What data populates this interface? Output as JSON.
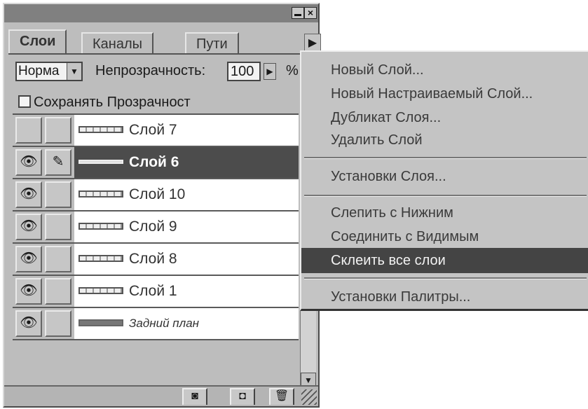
{
  "palette": {
    "tabs": [
      "Слои",
      "Каналы",
      "Пути"
    ],
    "blend_mode": "Норма",
    "opacity_label": "Непрозрачность:",
    "opacity_value": "100",
    "opacity_unit": "%",
    "preserve_transparency_label": "Сохранять Прозрачност",
    "layers": [
      {
        "name": "Слой 7",
        "visible": false,
        "active": false
      },
      {
        "name": "Слой 6",
        "visible": true,
        "active": true
      },
      {
        "name": "Слой 10",
        "visible": true,
        "active": false
      },
      {
        "name": "Слой 9",
        "visible": true,
        "active": false
      },
      {
        "name": "Слой 8",
        "visible": true,
        "active": false
      },
      {
        "name": "Слой 1",
        "visible": true,
        "active": false
      },
      {
        "name": "Задний план",
        "visible": true,
        "active": false
      }
    ],
    "icons": {
      "eye": "eye-icon",
      "brush": "brush-icon",
      "mask": "layer-mask-icon",
      "new_layer": "new-layer-icon",
      "trash": "trash-icon",
      "palette_menu": "palette-menu-arrow-icon"
    }
  },
  "flyout_menu": {
    "groups": [
      [
        "Новый Слой...",
        "Новый Настраиваемый Слой...",
        "Дубликат Слоя...",
        "Удалить Слой"
      ],
      [
        "Установки Слоя..."
      ],
      [
        "Слепить с Нижним",
        "Соединить с Видимым",
        "Склеить все слои"
      ],
      [
        "Установки Палитры..."
      ]
    ],
    "highlighted": "Склеить все слои"
  },
  "colors": {
    "highlight": "#444444",
    "panel": "#bdbdbd"
  }
}
